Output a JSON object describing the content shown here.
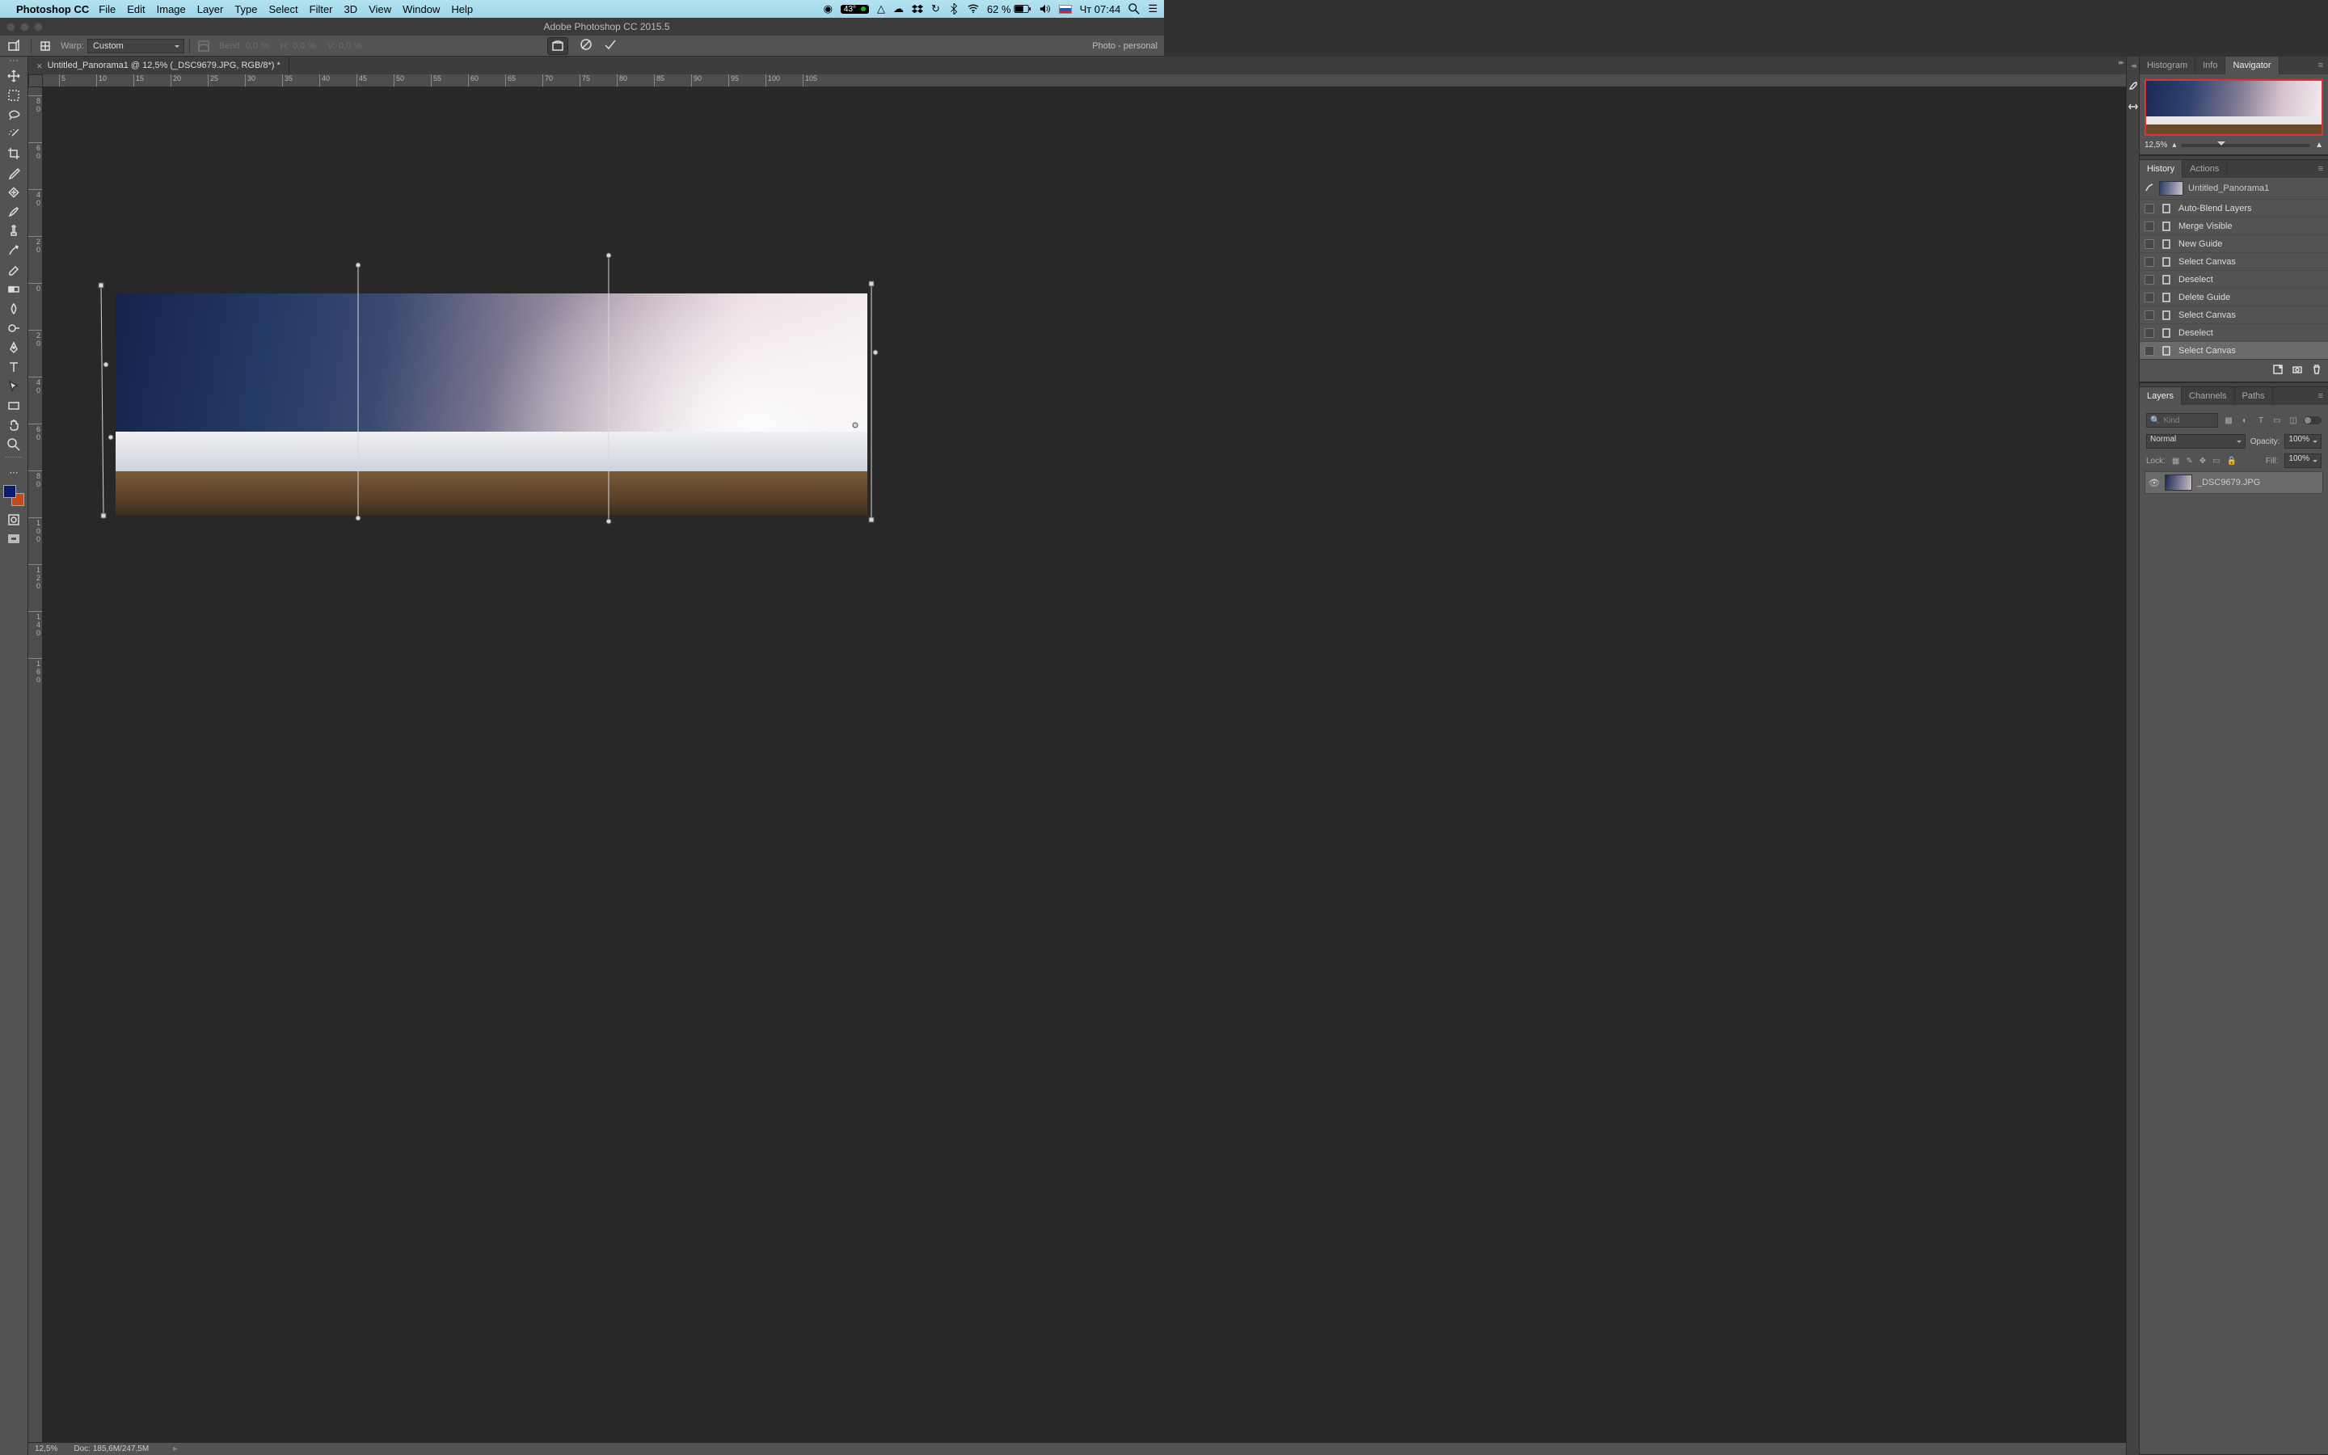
{
  "menubar": {
    "app": "Photoshop CC",
    "items": [
      "File",
      "Edit",
      "Image",
      "Layer",
      "Type",
      "Select",
      "Filter",
      "3D",
      "View",
      "Window",
      "Help"
    ],
    "temp": "43°",
    "battery": "62 %",
    "clock": "Чт 07:44"
  },
  "titlebar": {
    "title": "Adobe Photoshop CC 2015.5"
  },
  "optionsbar": {
    "warp_label": "Warp:",
    "warp_value": "Custom",
    "bend_label": "Bend:",
    "bend_value": "0,0",
    "pct": "%",
    "h_label": "H:",
    "h_value": "0,0",
    "v_label": "V:",
    "v_value": "0,0",
    "workspace": "Photo - personal"
  },
  "document": {
    "tab": "Untitled_Panorama1 @ 12,5% (_DSC9679.JPG, RGB/8*) *",
    "ruler_h": [
      "5",
      "10",
      "15",
      "20",
      "25",
      "30",
      "35",
      "40",
      "45",
      "50",
      "55",
      "60",
      "65",
      "70",
      "75",
      "80",
      "85",
      "90",
      "95",
      "100",
      "105"
    ],
    "ruler_v": [
      "8\n0",
      "6\n0",
      "4\n0",
      "2\n0",
      "0",
      "2\n0",
      "4\n0",
      "6\n0",
      "8\n0",
      "1\n0\n0",
      "1\n2\n0",
      "1\n4\n0",
      "1\n6\n0"
    ]
  },
  "status": {
    "zoom": "12,5%",
    "doc": "Doc: 185,6M/247,5M"
  },
  "panels": {
    "nav": {
      "tabs": [
        "Histogram",
        "Info",
        "Navigator"
      ],
      "active": 2,
      "zoom": "12,5%"
    },
    "history": {
      "tabs": [
        "History",
        "Actions"
      ],
      "active": 0,
      "snapshot": "Untitled_Panorama1",
      "rows": [
        "Auto-Blend Layers",
        "Merge Visible",
        "New Guide",
        "Select Canvas",
        "Deselect",
        "Delete Guide",
        "Select Canvas",
        "Deselect",
        "Select Canvas"
      ],
      "selected": 8
    },
    "layers": {
      "tabs": [
        "Layers",
        "Channels",
        "Paths"
      ],
      "active": 0,
      "kind_placeholder": "Kind",
      "blend": "Normal",
      "opacity_label": "Opacity:",
      "opacity": "100%",
      "lock_label": "Lock:",
      "fill_label": "Fill:",
      "fill": "100%",
      "layer_name": "_DSC9679.JPG"
    }
  }
}
